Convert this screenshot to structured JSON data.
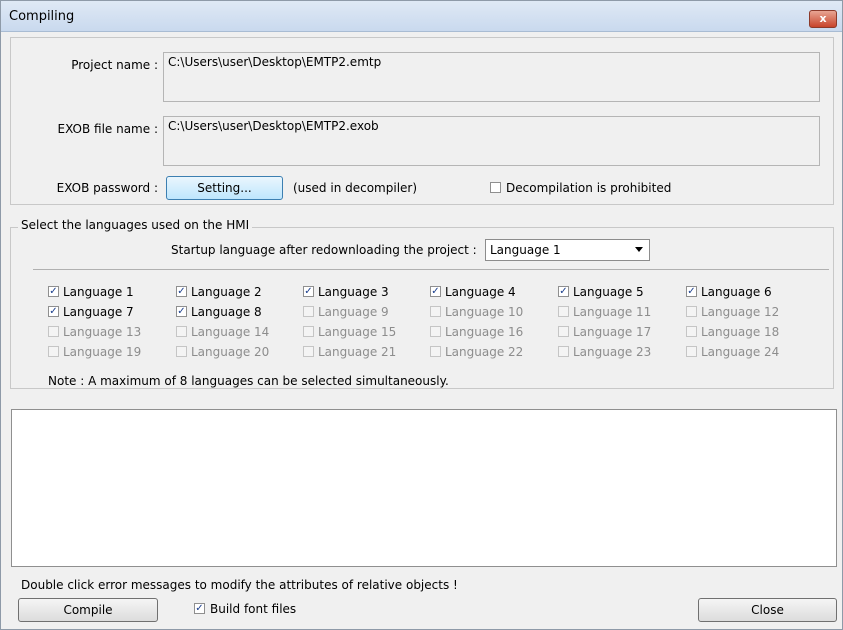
{
  "window": {
    "title": "Compiling",
    "close_glyph": "x"
  },
  "project": {
    "project_name_label": "Project name :",
    "project_name_value": "C:\\Users\\user\\Desktop\\EMTP2.emtp",
    "exob_name_label": "EXOB file name :",
    "exob_name_value": "C:\\Users\\user\\Desktop\\EMTP2.exob",
    "password_label": "EXOB password :",
    "setting_button": "Setting...",
    "setting_note": "(used in decompiler)",
    "decompile_label": "Decompilation is prohibited",
    "decompile_checked": false
  },
  "languages": {
    "group_label": "Select the languages used on the HMI",
    "startup_label": "Startup language after redownloading the project :",
    "startup_value": "Language 1",
    "items": [
      {
        "label": "Language 1",
        "checked": true,
        "enabled": true
      },
      {
        "label": "Language 2",
        "checked": true,
        "enabled": true
      },
      {
        "label": "Language 3",
        "checked": true,
        "enabled": true
      },
      {
        "label": "Language 4",
        "checked": true,
        "enabled": true
      },
      {
        "label": "Language 5",
        "checked": true,
        "enabled": true
      },
      {
        "label": "Language 6",
        "checked": true,
        "enabled": true
      },
      {
        "label": "Language 7",
        "checked": true,
        "enabled": true
      },
      {
        "label": "Language 8",
        "checked": true,
        "enabled": true
      },
      {
        "label": "Language 9",
        "checked": false,
        "enabled": false
      },
      {
        "label": "Language 10",
        "checked": false,
        "enabled": false
      },
      {
        "label": "Language 11",
        "checked": false,
        "enabled": false
      },
      {
        "label": "Language 12",
        "checked": false,
        "enabled": false
      },
      {
        "label": "Language 13",
        "checked": false,
        "enabled": false
      },
      {
        "label": "Language 14",
        "checked": false,
        "enabled": false
      },
      {
        "label": "Language 15",
        "checked": false,
        "enabled": false
      },
      {
        "label": "Language 16",
        "checked": false,
        "enabled": false
      },
      {
        "label": "Language 17",
        "checked": false,
        "enabled": false
      },
      {
        "label": "Language 18",
        "checked": false,
        "enabled": false
      },
      {
        "label": "Language 19",
        "checked": false,
        "enabled": false
      },
      {
        "label": "Language 20",
        "checked": false,
        "enabled": false
      },
      {
        "label": "Language 21",
        "checked": false,
        "enabled": false
      },
      {
        "label": "Language 22",
        "checked": false,
        "enabled": false
      },
      {
        "label": "Language 23",
        "checked": false,
        "enabled": false
      },
      {
        "label": "Language 24",
        "checked": false,
        "enabled": false
      }
    ],
    "note": "Note : A maximum of 8 languages can be selected simultaneously."
  },
  "footer": {
    "hint": "Double click error messages to modify the attributes of relative objects !",
    "compile_button": "Compile",
    "build_font_label": "Build font files",
    "build_font_checked": true,
    "close_button": "Close"
  }
}
